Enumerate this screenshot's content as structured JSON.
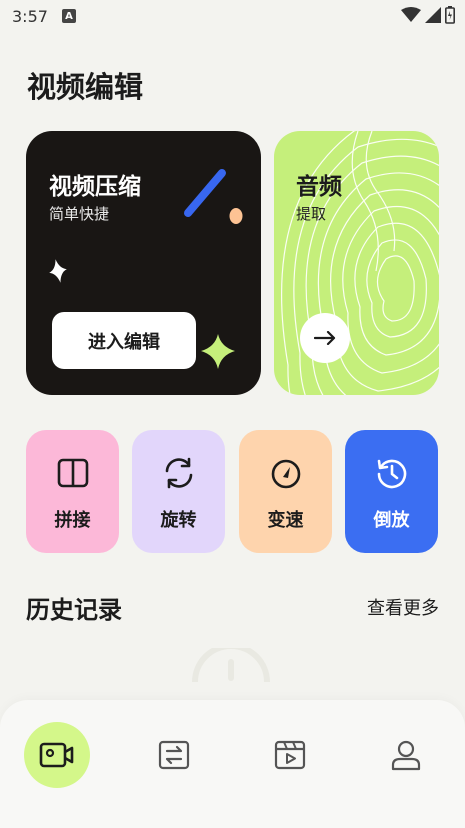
{
  "status_bar": {
    "time": "3:57",
    "notification_badge": "A"
  },
  "page": {
    "title": "视频编辑"
  },
  "compress_card": {
    "title": "视频压缩",
    "subtitle": "简单快捷",
    "button_label": "进入编辑"
  },
  "audio_card": {
    "title": "音频",
    "subtitle": "提取",
    "arrow": "→"
  },
  "tools": [
    {
      "label": "拼接",
      "icon": "split-panel-icon"
    },
    {
      "label": "旋转",
      "icon": "rotate-icon"
    },
    {
      "label": "变速",
      "icon": "speedometer-icon"
    },
    {
      "label": "倒放",
      "icon": "history-clock-icon"
    }
  ],
  "history": {
    "title": "历史记录",
    "more_label": "查看更多"
  },
  "bottom_nav": [
    {
      "icon": "video-camera-icon",
      "active": true
    },
    {
      "icon": "convert-icon",
      "active": false
    },
    {
      "icon": "video-player-icon",
      "active": false
    },
    {
      "icon": "user-icon",
      "active": false
    }
  ],
  "colors": {
    "background": "#f3f3ef",
    "compress_card": "#191614",
    "audio_card": "#c5ef7b",
    "splice": "#fcb8d8",
    "rotate": "#e2d6fb",
    "speed": "#fed4ad",
    "reverse": "#3b6ef2",
    "nav_active": "#d4f78a"
  }
}
